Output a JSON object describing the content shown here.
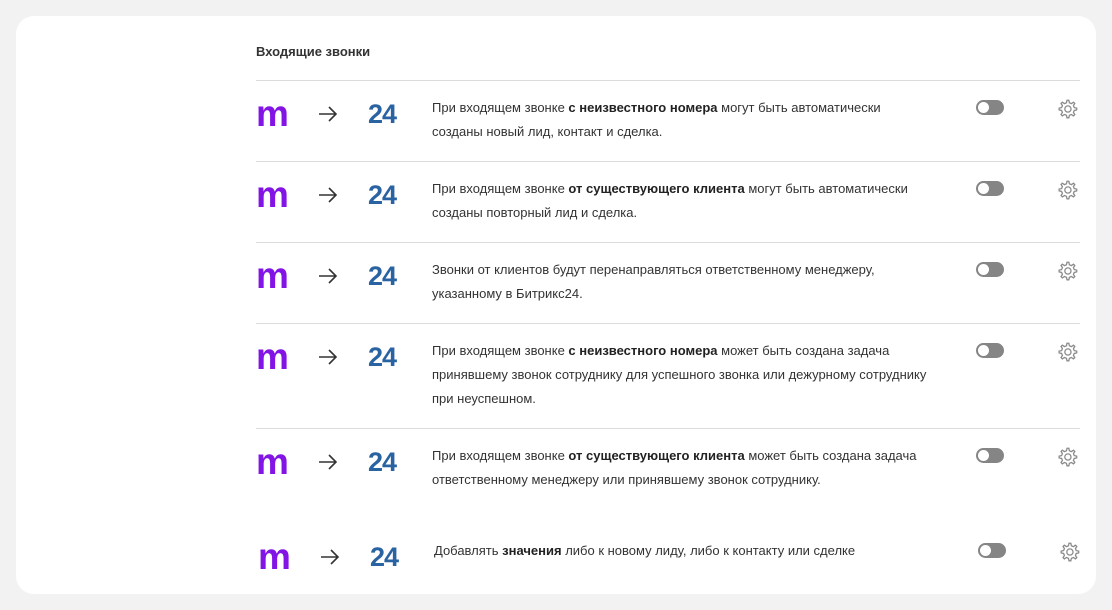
{
  "section": {
    "title": "Входящие звонки"
  },
  "logos": {
    "source": "m",
    "target": "24"
  },
  "rows": [
    {
      "parts": [
        "При входящем звонке ",
        "с неизвестного номера",
        " могут быть автоматически созданы новый лид, контакт и сделка.",
        ""
      ],
      "enabled": false
    },
    {
      "parts": [
        "При входящем звонке ",
        "от существующего клиента",
        " могут быть автоматически созданы повторный лид и сделка.",
        ""
      ],
      "enabled": false
    },
    {
      "parts": [
        "Звонки от клиентов будут перенаправляться ответственному менеджеру, указанному в Битрикс24.",
        "",
        "",
        ""
      ],
      "enabled": false
    },
    {
      "parts": [
        "При входящем звонке ",
        "с неизвестного номера",
        " может быть создана задача принявшему звонок сотруднику для успешного звонка или дежурному сотруднику при неуспешном.",
        ""
      ],
      "enabled": false
    },
    {
      "parts": [
        "При входящем звонке ",
        "от существующего клиента",
        " может быть создана задача ответственному менеджеру или принявшему звонок сотруднику.",
        ""
      ],
      "enabled": false
    },
    {
      "parts": [
        "Добавлять ",
        "значения",
        " либо к новому лиду, либо к контакту или сделке",
        ""
      ],
      "enabled": false
    }
  ],
  "colors": {
    "m_logo": "#8314e6",
    "b24_logo": "#2a63a1",
    "toggle_off": "#858585"
  },
  "icons": {
    "arrow": "arrow-right-icon",
    "settings": "gear-icon"
  }
}
